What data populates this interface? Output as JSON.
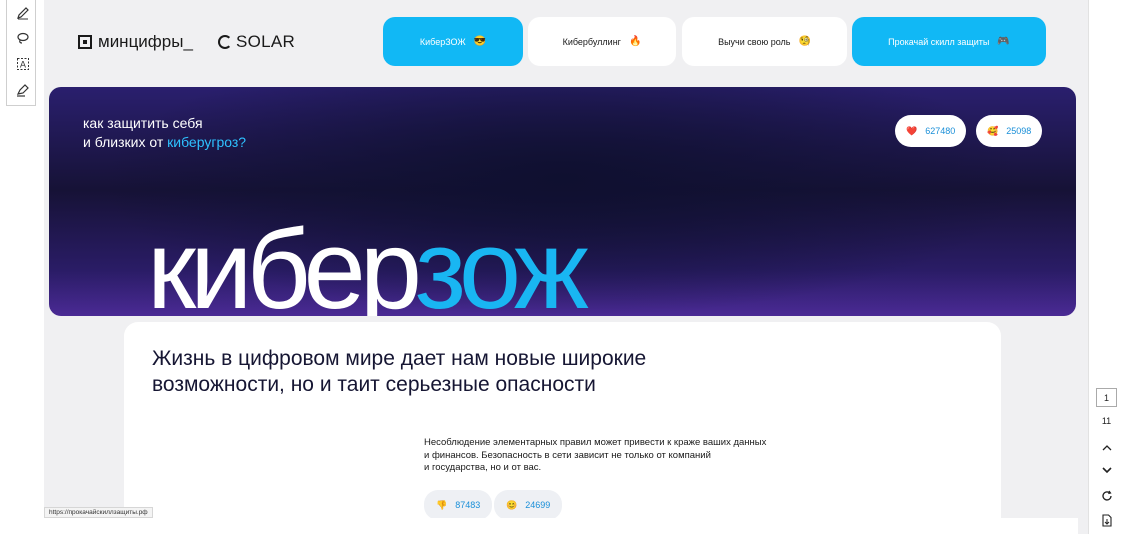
{
  "header": {
    "logo_minc": "минцифры_",
    "logo_solar": "SOLAR",
    "nav": [
      {
        "label": "КиберЗОЖ",
        "emoji": "😎"
      },
      {
        "label": "Кибербуллинг",
        "emoji": "🔥"
      },
      {
        "label": "Выучи свою роль",
        "emoji": "🧐"
      },
      {
        "label": "Прокачай скилл защиты",
        "emoji": "🎮"
      }
    ]
  },
  "hero": {
    "question_line1": "как защитить себя",
    "question_line2_prefix": "и близких от ",
    "question_line2_accent": "киберугроз?",
    "likes": {
      "emoji": "❤️",
      "count": "627480"
    },
    "smiles": {
      "emoji": "🥰",
      "count": "25098"
    },
    "big_white": "кибер",
    "big_blue": "зож"
  },
  "content": {
    "title": "Жизнь в цифровом мире дает нам новые широкие возможности, но и таит серьезные опасности",
    "text_line1": "Несоблюдение элементарных правил может привести к краже ваших данных",
    "text_line2": "и финансов. Безопасность в сети зависит не только от компаний",
    "text_line3": "и государства, но и от вас.",
    "reaction1": {
      "emoji": "👎",
      "count": "87483"
    },
    "reaction2": {
      "emoji": "😊",
      "count": "24699"
    }
  },
  "status_url": "https://прокачайскиллзащиты.рф",
  "pdf": {
    "current_page": "1",
    "total_pages": "11"
  },
  "colors": {
    "accent": "#11b8f5",
    "hero_dark": "#161236",
    "hero_purple": "#4a2a94"
  }
}
